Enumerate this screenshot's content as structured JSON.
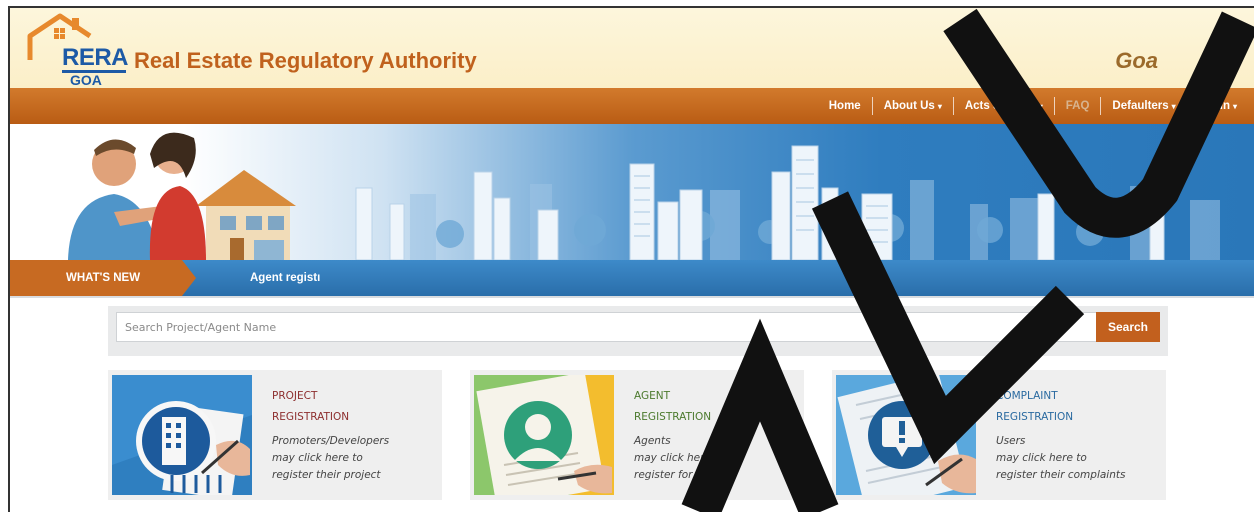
{
  "header": {
    "logo": {
      "rera": "RERA",
      "goa": "GOA"
    },
    "title": "Real Estate Regulatory Authority",
    "state": "Goa"
  },
  "nav": {
    "items": [
      {
        "label": "Home",
        "caret": ""
      },
      {
        "label": "About Us",
        "caret": "▾"
      },
      {
        "label": "Acts & Rules",
        "caret": "▾"
      },
      {
        "label": "FAQ",
        "caret": ""
      },
      {
        "label": "Defaulters",
        "caret": "▾"
      },
      {
        "label": "Login",
        "caret": "▾"
      }
    ]
  },
  "whats_new": {
    "label": "WHAT'S NEW",
    "ticker": "Agent registı"
  },
  "search": {
    "placeholder": "Search Project/Agent Name",
    "value": "",
    "button_label": "Search"
  },
  "cards": [
    {
      "title_line1": "PROJECT",
      "title_line2": "REGISTRATION",
      "desc_line1": "Promoters/Developers",
      "desc_line2": "may click here to",
      "desc_line3": "register their project"
    },
    {
      "title_line1": "AGENT",
      "title_line2": "REGISTRATION",
      "desc_line1": "Agents",
      "desc_line2": "may click here to",
      "desc_line3": "register for project"
    },
    {
      "title_line1": "COMPLAINT",
      "title_line2": "REGISTRATION",
      "desc_line1": "Users",
      "desc_line2": "may click here to",
      "desc_line3": "register their complaints"
    }
  ],
  "colors": {
    "brand_orange": "#c2601e",
    "brand_blue": "#1d5aa6",
    "header_bg": "#fbefc8",
    "banner_blue": "#2f7dbf"
  }
}
